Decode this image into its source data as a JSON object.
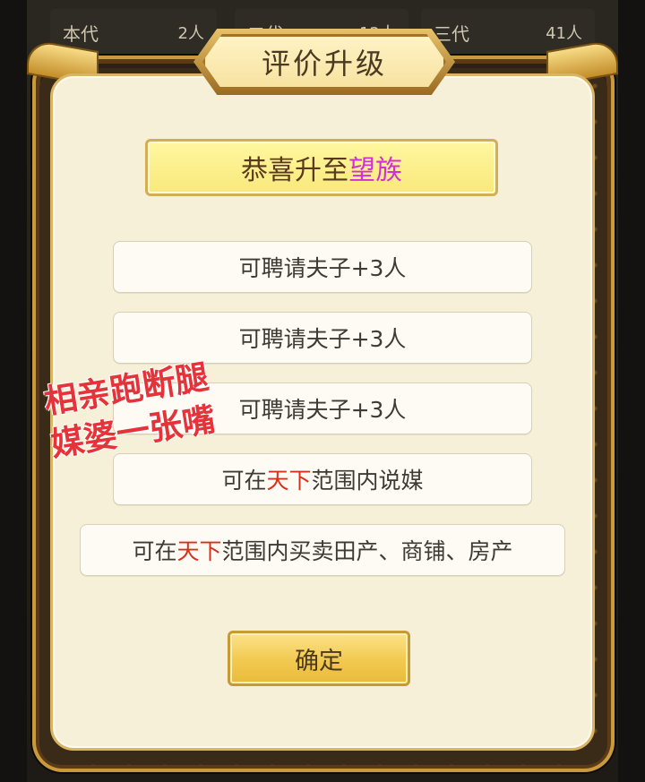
{
  "background_tabs": [
    {
      "label": "本代",
      "count": "2人"
    },
    {
      "label": "二代",
      "count": "12人"
    },
    {
      "label": "三代",
      "count": "41人"
    }
  ],
  "dialog": {
    "title": "评价升级",
    "congrats_prefix": "恭喜升至",
    "congrats_rank": "望族",
    "rewards": [
      {
        "before": "可聘请夫子+3人",
        "highlight": "",
        "after": ""
      },
      {
        "before": "可聘请夫子+3人",
        "highlight": "",
        "after": ""
      },
      {
        "before": "可聘请夫子+3人",
        "highlight": "",
        "after": ""
      },
      {
        "before": "可在",
        "highlight": "天下",
        "after": "范围内说媒"
      },
      {
        "before": "可在",
        "highlight": "天下",
        "after": "范围内买卖田产、商铺、房产"
      }
    ],
    "confirm_label": "确定"
  },
  "watermark": {
    "line1": "相亲跑断腿",
    "line2": "媒婆一张嘴"
  },
  "colors": {
    "rank_highlight": "#d22fd8",
    "scope_highlight": "#d9301e",
    "watermark": "#e5333a"
  }
}
